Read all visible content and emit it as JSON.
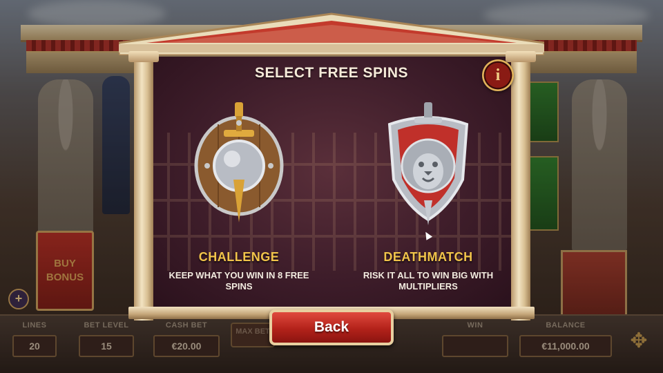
{
  "modal": {
    "title": "SELECT FREE SPINS",
    "info_icon": "i",
    "options": [
      {
        "title": "CHALLENGE",
        "description": "KEEP WHAT YOU WIN IN 8 FREE SPINS",
        "icon": "shield-sword-icon"
      },
      {
        "title": "DEATHMATCH",
        "description": "RISK IT ALL TO WIN BIG WITH MULTIPLIERS",
        "icon": "lion-shield-icon"
      }
    ],
    "back_label": "Back"
  },
  "game": {
    "buy_bonus_label": "BUY BONUS",
    "plus_label": "+",
    "max_bet_label": "MAX BET"
  },
  "hud": {
    "lines_label": "LINES",
    "lines_value": "20",
    "bet_level_label": "BET LEVEL",
    "bet_level_value": "15",
    "cash_bet_label": "CASH BET",
    "cash_bet_value": "€20.00",
    "win_label": "WIN",
    "win_value": "",
    "balance_label": "BALANCE",
    "balance_value": "€11,000.00"
  },
  "colors": {
    "accent_gold": "#f1c44a",
    "back_red": "#b3221a",
    "panel_maroon": "#3e1d2a"
  }
}
